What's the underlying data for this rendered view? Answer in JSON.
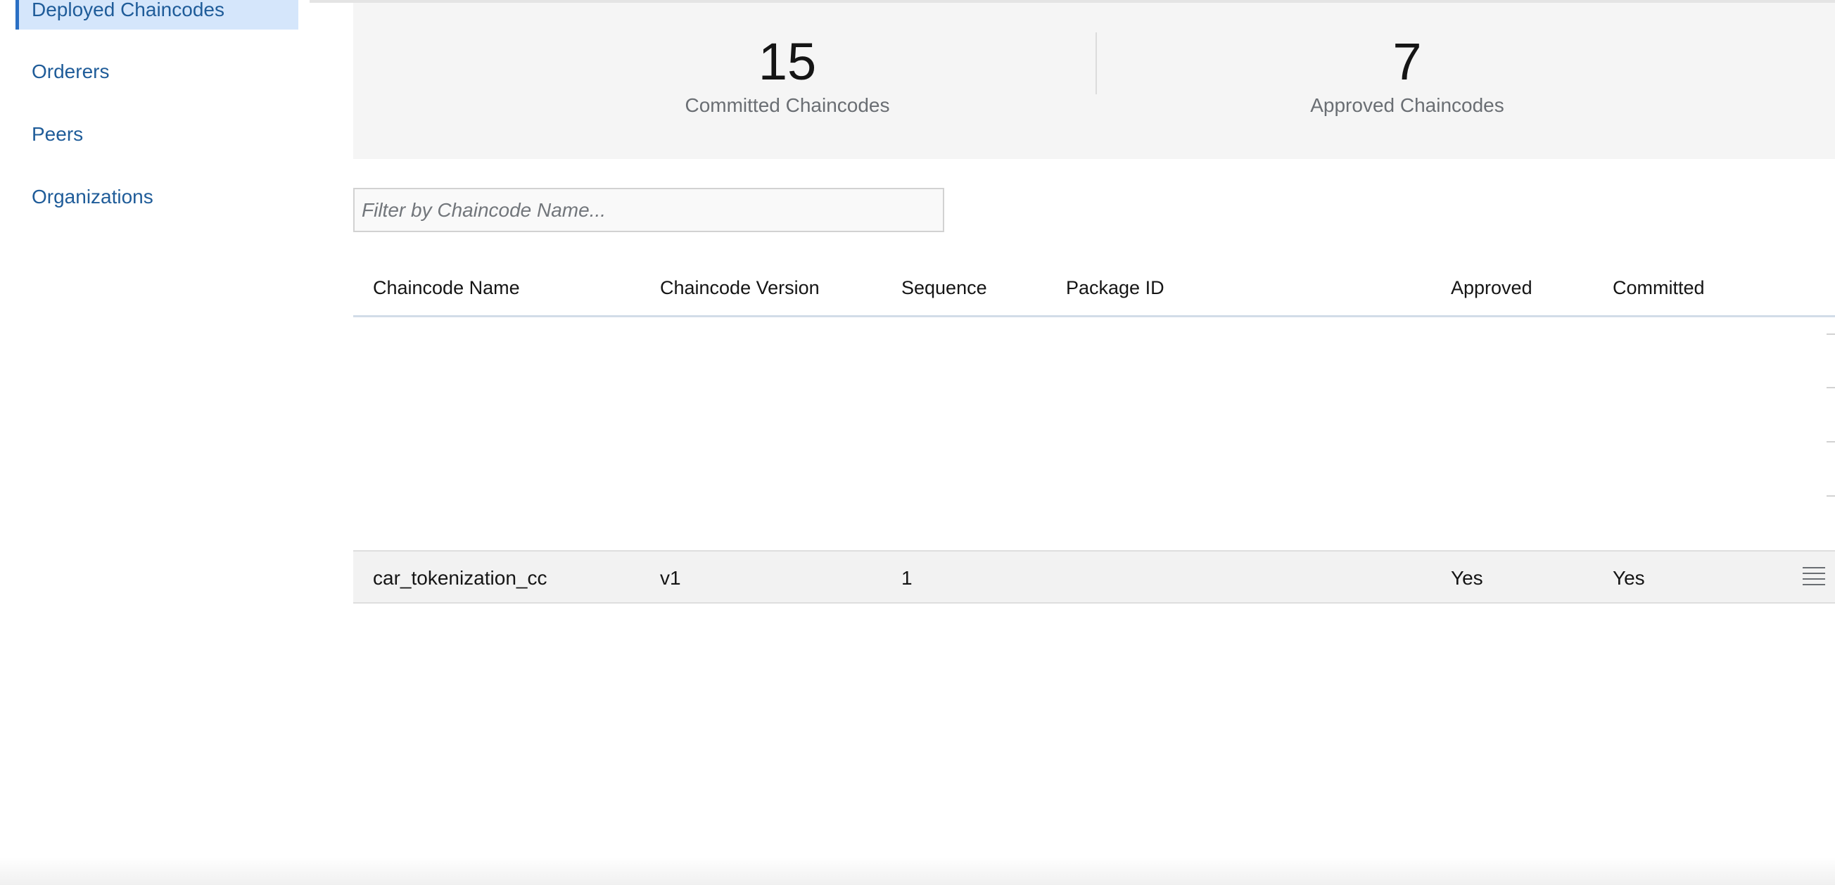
{
  "sidebar": {
    "items": [
      {
        "label": "Deployed Chaincodes",
        "active": true
      },
      {
        "label": "Orderers",
        "active": false
      },
      {
        "label": "Peers",
        "active": false
      },
      {
        "label": "Organizations",
        "active": false
      }
    ]
  },
  "stats": {
    "committed": {
      "value": "15",
      "label": "Committed Chaincodes"
    },
    "approved": {
      "value": "7",
      "label": "Approved Chaincodes"
    }
  },
  "filter": {
    "placeholder": "Filter by Chaincode Name...",
    "value": ""
  },
  "table": {
    "columns": [
      "Chaincode Name",
      "Chaincode Version",
      "Sequence",
      "Package ID",
      "Approved",
      "Committed"
    ],
    "rows": [
      {
        "name": "car_tokenization_cc",
        "version": "v1",
        "sequence": "1",
        "package_id": "",
        "approved": "Yes",
        "committed": "Yes"
      }
    ]
  },
  "icons": {
    "row_actions": "menu-lines-icon"
  },
  "colors": {
    "accent": "#2a6fc4",
    "link": "#1f5c99",
    "active_bg": "#d5e6fb",
    "panel_bg": "#f5f5f5"
  }
}
